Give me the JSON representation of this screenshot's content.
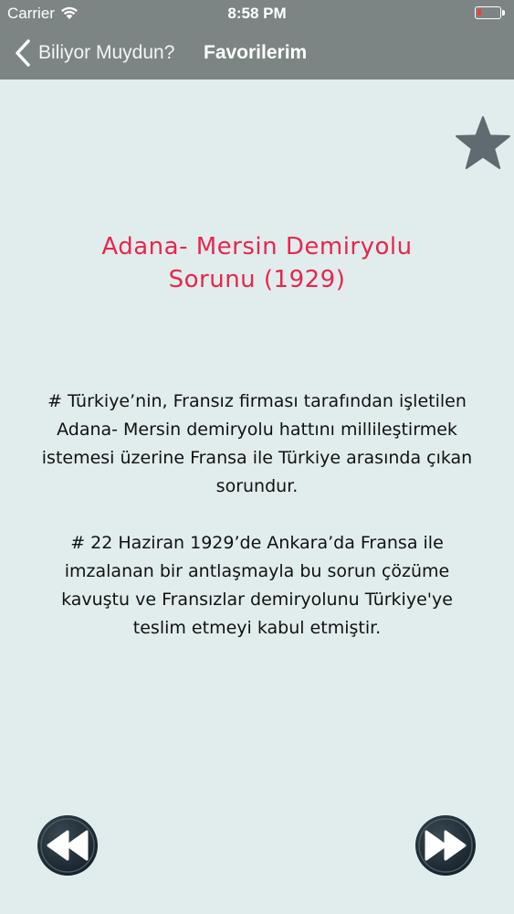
{
  "status_bar": {
    "carrier": "Carrier",
    "time": "8:58 PM",
    "icons": [
      "wifi-icon",
      "battery-icon"
    ],
    "battery_color": "#ff3b30"
  },
  "nav": {
    "back_label": "Biliyor Muydun?",
    "title": "Favorilerim",
    "background_color": "#7c8583"
  },
  "fact": {
    "title_line1": "Adana- Mersin Demiryolu",
    "title_line2": "Sorunu (1929)",
    "title_color": "#e8264f",
    "paragraph1": "# Türkiye’nin, Fransız firması tarafından işletilen Adana- Mersin demiryolu hattını millileştirmek istemesi üzerine Fransa ile Türkiye arasında çıkan sorundur.",
    "paragraph2": "# 22 Haziran 1929’de Ankara’da Fransa ile imzalanan bir antlaşmayla bu sorun çözüme kavuştu ve Fransızlar demiryolunu Türkiye'ye teslim etmeyi kabul etmiştir."
  },
  "controls": {
    "favorite_icon": "star-icon",
    "previous_icon": "rewind-icon",
    "next_icon": "fast-forward-icon"
  },
  "background_color": "#e1eded"
}
